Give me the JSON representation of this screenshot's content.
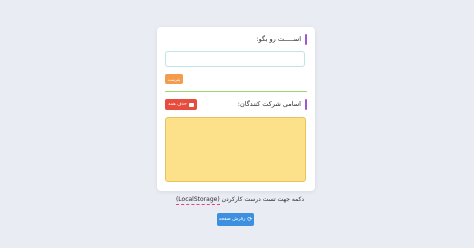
{
  "form": {
    "name_heading": "اســـــت رو بگو:",
    "name_input_value": "",
    "submit_label": "بفرست"
  },
  "participants": {
    "heading": "اسامی شرکت کنندگان:",
    "clear_label": "حذف همه",
    "clear_icon": "trash-icon",
    "items": []
  },
  "footer": {
    "note_text": "دکمه جهت تست درست کارکردن",
    "note_code": "(LocalStorage)",
    "refresh_label": "رفرش صفحه",
    "refresh_icon": "refresh-icon"
  },
  "colors": {
    "accent": "#9b59d0",
    "submit": "#f39c4d",
    "divider": "#9ad66a",
    "clear": "#e74c3c",
    "list_bg": "#fde08a",
    "refresh": "#3d8fe0"
  }
}
